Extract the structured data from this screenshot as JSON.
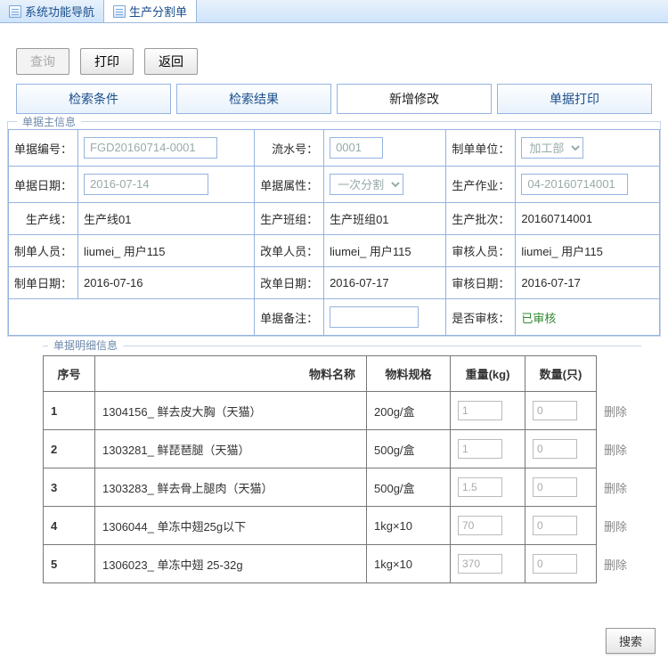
{
  "tabs": [
    {
      "label": "系统功能导航",
      "active": false
    },
    {
      "label": "生产分割单",
      "active": true
    }
  ],
  "toolbar": {
    "query": "查询",
    "print": "打印",
    "back": "返回"
  },
  "section_tabs": [
    {
      "label": "检索条件",
      "active": false
    },
    {
      "label": "检索结果",
      "active": false
    },
    {
      "label": "新增修改",
      "active": true
    },
    {
      "label": "单据打印",
      "active": false
    }
  ],
  "master_legend": "单据主信息",
  "detail_legend": "单据明细信息",
  "fields": {
    "doc_no_lbl": "单据编号：",
    "doc_no": "FGD20160714-0001",
    "serial_lbl": "流水号：",
    "serial": "0001",
    "maker_unit_lbl": "制单单位：",
    "maker_unit": "加工部",
    "doc_date_lbl": "单据日期：",
    "doc_date": "2016-07-14",
    "doc_attr_lbl": "单据属性：",
    "doc_attr": "一次分割",
    "job_lbl": "生产作业：",
    "job": "04-20160714001",
    "line_lbl": "生产线：",
    "line": "生产线01",
    "team_lbl": "生产班组：",
    "team": "生产班组01",
    "batch_lbl": "生产批次：",
    "batch": "20160714001",
    "maker_lbl": "制单人员：",
    "maker": "liumei_ 用户115",
    "editor_lbl": "改单人员：",
    "editor": "liumei_ 用户115",
    "auditor_lbl": "审核人员：",
    "auditor": "liumei_ 用户115",
    "make_date_lbl": "制单日期：",
    "make_date": "2016-07-16",
    "edit_date_lbl": "改单日期：",
    "edit_date": "2016-07-17",
    "audit_date_lbl": "审核日期：",
    "audit_date": "2016-07-17",
    "remark_lbl": "单据备注：",
    "audited_lbl": "是否审核：",
    "audited": "已审核"
  },
  "cols": {
    "idx": "序号",
    "name": "物料名称",
    "spec": "物料规格",
    "weight": "重量(kg)",
    "qty": "数量(只)",
    "del": "删除"
  },
  "rows": [
    {
      "idx": "1",
      "name": "1304156_ 鲜去皮大胸（天猫）",
      "spec": "200g/盒",
      "weight": "1",
      "qty": "0"
    },
    {
      "idx": "2",
      "name": "1303281_ 鲜琵琶腿（天猫）",
      "spec": "500g/盒",
      "weight": "1",
      "qty": "0"
    },
    {
      "idx": "3",
      "name": "1303283_ 鲜去骨上腿肉（天猫）",
      "spec": "500g/盒",
      "weight": "1.5",
      "qty": "0"
    },
    {
      "idx": "4",
      "name": "1306044_ 单冻中翅25g以下",
      "spec": "1kg×10",
      "weight": "70",
      "qty": "0"
    },
    {
      "idx": "5",
      "name": "1306023_ 单冻中翅 25-32g",
      "spec": "1kg×10",
      "weight": "370",
      "qty": "0"
    }
  ],
  "search_btn": "搜索"
}
